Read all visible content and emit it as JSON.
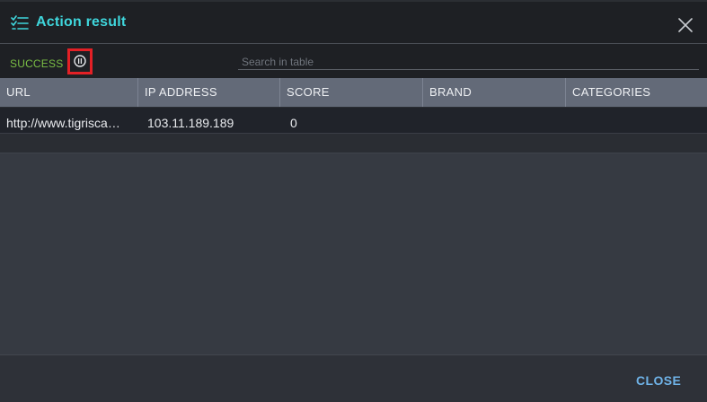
{
  "dialog": {
    "title": "Action result",
    "title_icon": "checklist-icon",
    "close_icon": "close-icon"
  },
  "toolbar": {
    "status": "SUCCESS",
    "status_color": "#7bbf45",
    "info_icon": "info-icon",
    "search_placeholder": "Search in table"
  },
  "table": {
    "columns": [
      "URL",
      "IP ADDRESS",
      "SCORE",
      "BRAND",
      "CATEGORIES"
    ],
    "rows": [
      [
        "http://www.tigrisca…",
        "103.11.189.189",
        "0",
        "",
        ""
      ]
    ]
  },
  "footer": {
    "close_label": "CLOSE"
  },
  "colors": {
    "accent": "#3fd6dc",
    "close_link": "#6fb3e8",
    "highlight_border": "#e32026"
  }
}
